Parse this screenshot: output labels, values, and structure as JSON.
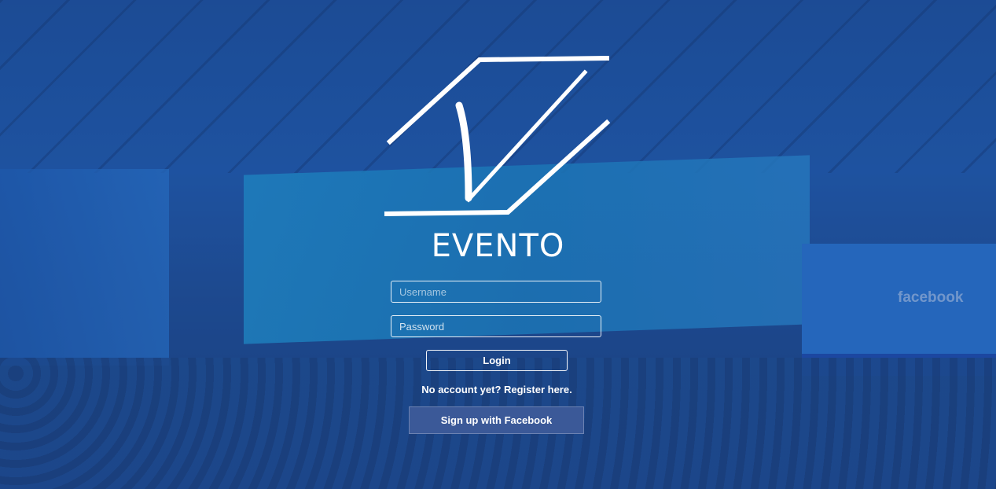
{
  "brand": {
    "name": "EVENTO"
  },
  "background": {
    "sponsor_text": "facebook"
  },
  "login_form": {
    "username_placeholder": "Username",
    "password_placeholder": "Password",
    "login_label": "Login",
    "register_text": "No account yet? Register here.",
    "facebook_label": "Sign up with Facebook"
  },
  "colors": {
    "overlay": "#1e4696",
    "facebook_button": "#3b5998",
    "text": "#ffffff"
  }
}
